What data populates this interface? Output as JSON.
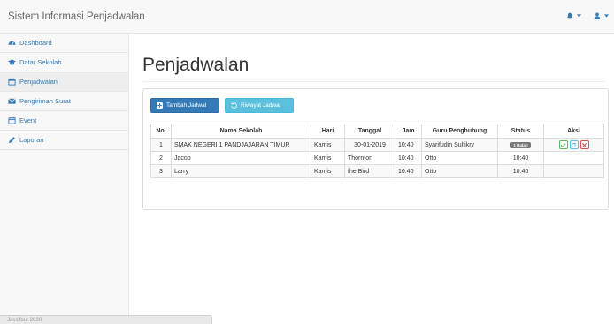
{
  "app": {
    "brand": "Sistem Informasi Penjadwalan"
  },
  "sidebar": {
    "items": [
      {
        "label": "Dashboard",
        "icon": "dashboard-icon"
      },
      {
        "label": "Datar Sekolah",
        "icon": "graduation-cap-icon"
      },
      {
        "label": "Penjadwalan",
        "icon": "calendar-icon",
        "active": true
      },
      {
        "label": "Pengiriman Surat",
        "icon": "envelope-icon"
      },
      {
        "label": "Event",
        "icon": "calendar-event-icon"
      },
      {
        "label": "Laporan",
        "icon": "pencil-icon"
      }
    ]
  },
  "footer": {
    "text": "Jassifour 2020"
  },
  "main": {
    "title": "Penjadwalan",
    "buttons": {
      "tambah": "Tambah Jadwal",
      "riwayat": "Riwayat Jadwal"
    },
    "table": {
      "headers": [
        "No.",
        "Nama Sekolah",
        "Hari",
        "Tanggal",
        "Jam",
        "Guru Penghubung",
        "Status",
        "Aksi"
      ],
      "rows": [
        {
          "no": "1",
          "nama": "SMAK NEGERI 1 PANDJAJARAN TIMUR",
          "hari": "Kamis",
          "tanggal": "30-01-2019",
          "jam": "10:40",
          "guru": "Syarifudin Sulfikry",
          "status": "1 Bulan"
        },
        {
          "no": "2",
          "nama": "Jacob",
          "hari": "Kamis",
          "tanggal": "Thornton",
          "jam": "10:40",
          "guru": "Otto",
          "status": "10:40"
        },
        {
          "no": "3",
          "nama": "Larry",
          "hari": "Kamis",
          "tanggal": "the Bird",
          "jam": "10:40",
          "guru": "Otto",
          "status": "10:40"
        }
      ]
    }
  },
  "colors": {
    "primary": "#337ab7",
    "info": "#5bc0de",
    "success": "#5cb85c",
    "danger": "#d9534f",
    "badge": "#777777"
  }
}
